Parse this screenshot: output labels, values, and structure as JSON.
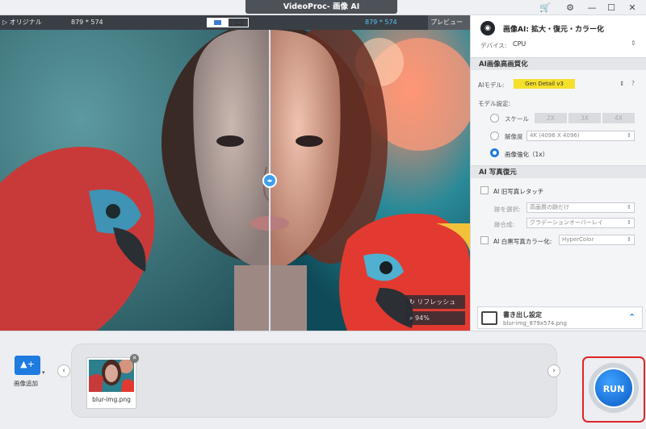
{
  "app": {
    "title": "VideoProc- 画像 AI"
  },
  "window": {
    "cart_icon": "shopping-cart-icon",
    "settings_icon": "gear-icon",
    "minimize": "—",
    "maximize": "☐",
    "close": "✕"
  },
  "preview": {
    "original_label": "▷ オリジナル",
    "original_resolution": "879 * 574",
    "enhanced_resolution": "879 * 574",
    "preview_button": "プレビュー",
    "refresh_label": "リフレッシュ",
    "zoom_level": "94%"
  },
  "panel": {
    "title": "画像AI: 拡大・復元・カラー化",
    "device_label": "デバイス:",
    "device_value": "CPU",
    "section_enhance": "AI画像高画質化",
    "model_label": "AIモデル:",
    "model_value": "Gen Detail v3",
    "model_settings_label": "モデル設定:",
    "scale_label": "スケール",
    "scale_options": [
      "2X",
      "3X",
      "4X"
    ],
    "resolution_label": "解像度",
    "resolution_value": "4K (4096 X 4096)",
    "enhance_label": "画像強化（1x）",
    "section_restore": "AI 写真復元",
    "old_photo_label": "AI 旧写真レタッチ",
    "select_scratch_label": "跡を選択:",
    "select_scratch_value": "高画質の跡だけ",
    "blend_label": "跡合成:",
    "blend_value": "グラデーションオーバーレイ",
    "colorize_label": "AI 白黒写真カラー化:",
    "colorize_value": "HyperColor",
    "export_title": "書き出し設定",
    "export_file": "blur-img_879x574.png"
  },
  "bottom": {
    "add_image_label": "画像追加",
    "thumbnail_name": "blur-img.png",
    "run_label": "RUN"
  },
  "colors": {
    "accent": "#1e7be0",
    "model_highlight": "#f4e02b",
    "run_outline": "#e02525"
  }
}
